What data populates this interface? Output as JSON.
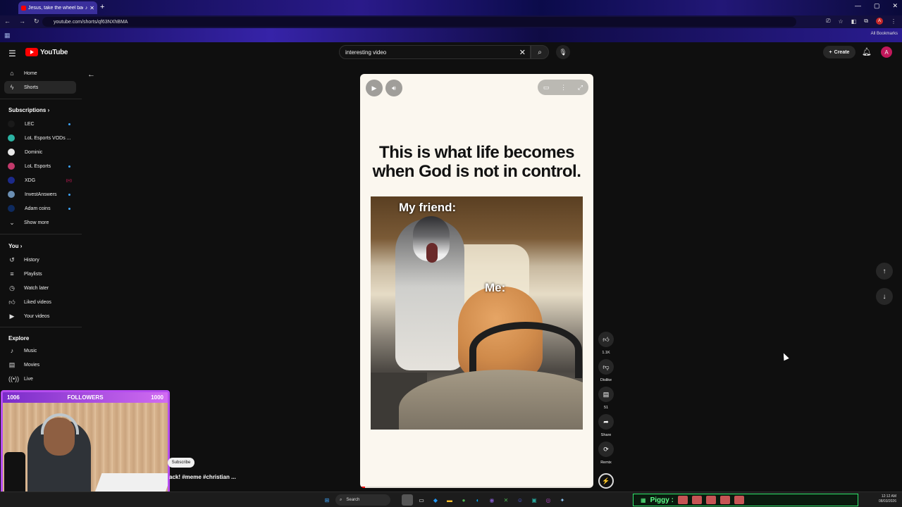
{
  "browser": {
    "tab_title": "Jesus, take the wheel back!",
    "url": "youtube.com/shorts/qf63NXhBMA",
    "all_bookmarks": "All Bookmarks"
  },
  "header": {
    "logo_text": "YouTube",
    "search_value": "interesting video",
    "create_label": "Create",
    "avatar_letter": "A"
  },
  "sidebar": {
    "primary": [
      {
        "label": "Home",
        "icon": "home-icon"
      },
      {
        "label": "Shorts",
        "icon": "shorts-icon"
      }
    ],
    "subscriptions_heading": "Subscriptions",
    "subscriptions": [
      {
        "label": "LEC",
        "color": "#1a1a1a",
        "badge": "dot"
      },
      {
        "label": "LoL Esports VODs ...",
        "color": "#2bb3a3",
        "badge": ""
      },
      {
        "label": "Dominic",
        "color": "#e8e8e8",
        "badge": ""
      },
      {
        "label": "LoL Esports",
        "color": "#c23a6b",
        "badge": "dot"
      },
      {
        "label": "XDG",
        "color": "#1c2a8a",
        "badge": "live"
      },
      {
        "label": "InvestAnswers",
        "color": "#6b8fb3",
        "badge": "dot"
      },
      {
        "label": "Adam coins",
        "color": "#0e2a5e",
        "badge": "dot"
      }
    ],
    "show_more": "Show more",
    "you_heading": "You",
    "you": [
      {
        "label": "History",
        "icon": "history-icon"
      },
      {
        "label": "Playlists",
        "icon": "playlists-icon"
      },
      {
        "label": "Watch later",
        "icon": "watch-later-icon"
      },
      {
        "label": "Liked videos",
        "icon": "liked-icon"
      },
      {
        "label": "Your videos",
        "icon": "your-videos-icon"
      }
    ],
    "explore_heading": "Explore",
    "explore": [
      {
        "label": "Music",
        "icon": "music-icon"
      },
      {
        "label": "Movies",
        "icon": "movies-icon"
      },
      {
        "label": "Live",
        "icon": "live-icon"
      }
    ]
  },
  "short": {
    "caption_line1": "This is what life becomes",
    "caption_line2": "when God is not in control.",
    "label_friend": "My friend:",
    "label_me": "Me:",
    "title": "ack! #meme #christian ...",
    "subscribe": "Subscribe",
    "progress": 0.02
  },
  "actions": {
    "likes": "1.1K",
    "dislike": "Dislike",
    "comments": "51",
    "share": "Share",
    "remix": "Remix"
  },
  "overlay": {
    "followers_left": "1006",
    "followers_label": "FOLLOWERS",
    "followers_right": "1000"
  },
  "taskbar": {
    "search": "Search",
    "piggy": "Piggy :",
    "time": "12:12 AM",
    "date": "08/03/2026"
  }
}
